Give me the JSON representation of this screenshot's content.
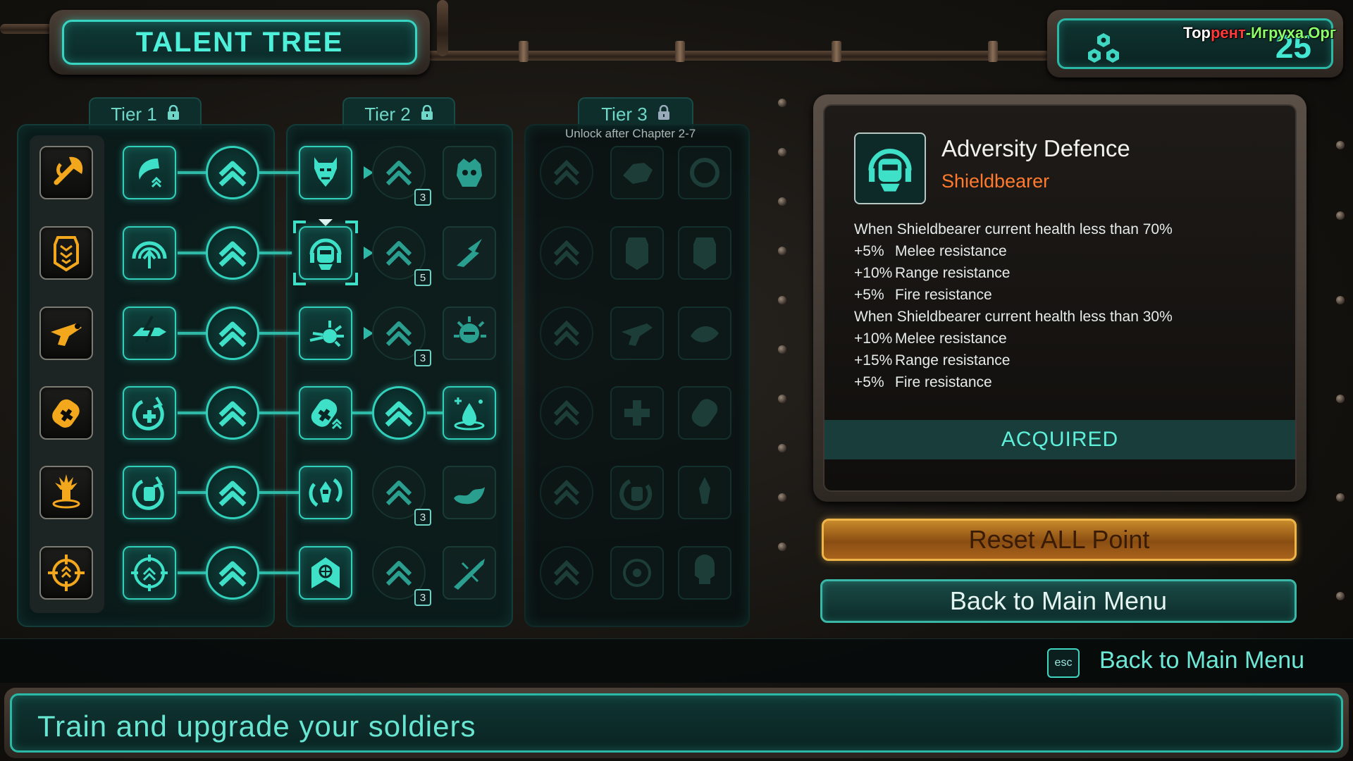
{
  "header": {
    "title": "TALENT TREE",
    "points": "25",
    "watermark_a": "Тор",
    "watermark_b": "рент",
    "watermark_c": "-Игруха.Орг"
  },
  "tiers": [
    {
      "label": "Tier 1",
      "locked_icon": "lock-icon"
    },
    {
      "label": "Tier 2",
      "locked_icon": "lock-icon"
    },
    {
      "label": "Tier 3",
      "locked_icon": "lock-icon",
      "note": "Unlock after Chapter 2-7"
    }
  ],
  "badges": [
    "3",
    "5",
    "3",
    "3",
    "3"
  ],
  "detail": {
    "name": "Adversity Defence",
    "class": "Shieldbearer",
    "condition_1": "When Shieldbearer current health less than 70%",
    "bonuses_1": [
      {
        "value": "+5%",
        "stat": "Melee resistance"
      },
      {
        "value": "+10%",
        "stat": "Range resistance"
      },
      {
        "value": "+5%",
        "stat": "Fire resistance"
      }
    ],
    "condition_2": "When Shieldbearer current health less than 30%",
    "bonuses_2": [
      {
        "value": "+10%",
        "stat": "Melee resistance"
      },
      {
        "value": "+15%",
        "stat": "Range resistance"
      },
      {
        "value": "+5%",
        "stat": "Fire resistance"
      }
    ],
    "status": "ACQUIRED"
  },
  "buttons": {
    "reset": "Reset ALL Point",
    "back": "Back to Main Menu"
  },
  "hint": {
    "key": "esc",
    "label": "Back to Main Menu"
  },
  "footer": "Train and upgrade your soldiers",
  "colors": {
    "accent": "#38d6c2",
    "gold": "#f0b548",
    "class": "#ff7a2c"
  }
}
